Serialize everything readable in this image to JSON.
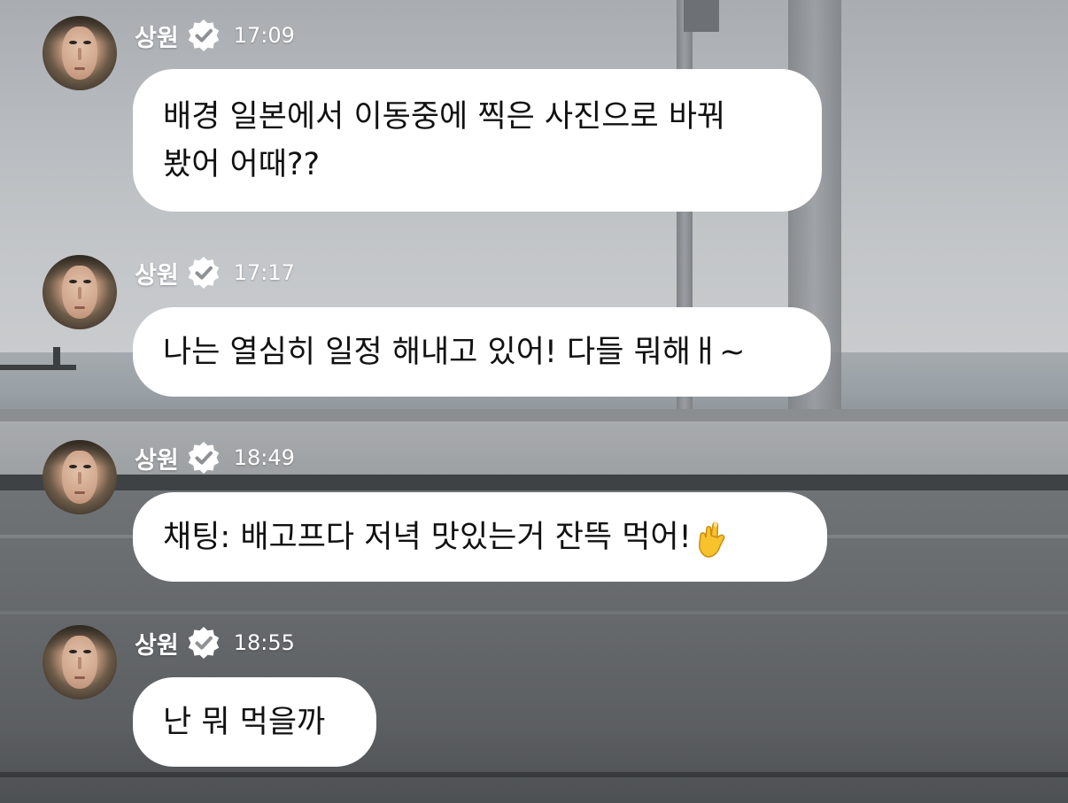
{
  "messages": [
    {
      "sender": "상원",
      "time": "17:09",
      "text": "배경 일본에서 이동중에 찍은 사진으로 바꿔\n봤어 어때??"
    },
    {
      "sender": "상원",
      "time": "17:17",
      "text": "나는 열심히 일정 해내고 있어! 다들 뭐해ㅐ~"
    },
    {
      "sender": "상원",
      "time": "18:49",
      "text": "채팅: 배고프다 저녁 맛있는거 잔뜩 먹어!",
      "emoji": "finger-heart-emoji"
    },
    {
      "sender": "상원",
      "time": "18:55",
      "text": "난 뭐 먹을까"
    }
  ],
  "icons": {
    "verified": "verified-badge-icon",
    "avatar": "profile-avatar"
  },
  "colors": {
    "bubble": "#ffffff",
    "text": "#111111",
    "meta_text": "#ffffff"
  }
}
